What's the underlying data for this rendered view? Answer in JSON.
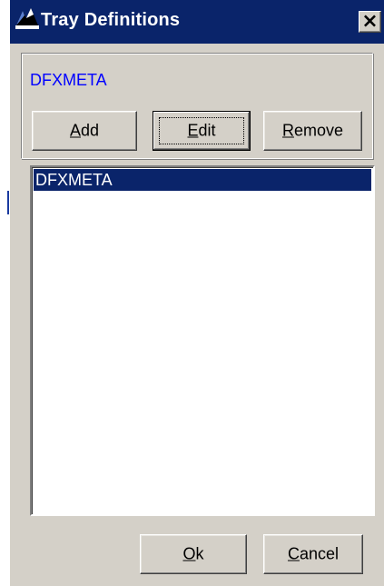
{
  "window": {
    "title": "Tray Definitions",
    "close_label": "×"
  },
  "tray_group": {
    "current_tray": "DFXMETA",
    "buttons": {
      "add": {
        "mnemonic": "A",
        "rest": "dd"
      },
      "edit": {
        "mnemonic": "E",
        "rest": "dit"
      },
      "remove": {
        "mnemonic": "R",
        "rest": "emove"
      }
    }
  },
  "tray_list": {
    "items": [
      "DFXMETA"
    ],
    "selected_index": 0
  },
  "footer": {
    "ok": {
      "mnemonic": "O",
      "rest": "k"
    },
    "cancel": {
      "mnemonic": "C",
      "rest": "ancel"
    }
  },
  "colors": {
    "title_bar": "#0a246a",
    "dialog_face": "#d4d0c8",
    "selection": "#0a246a",
    "tray_label": "#0000ff"
  },
  "icons": {
    "app": "app-icon",
    "close": "close-icon"
  }
}
